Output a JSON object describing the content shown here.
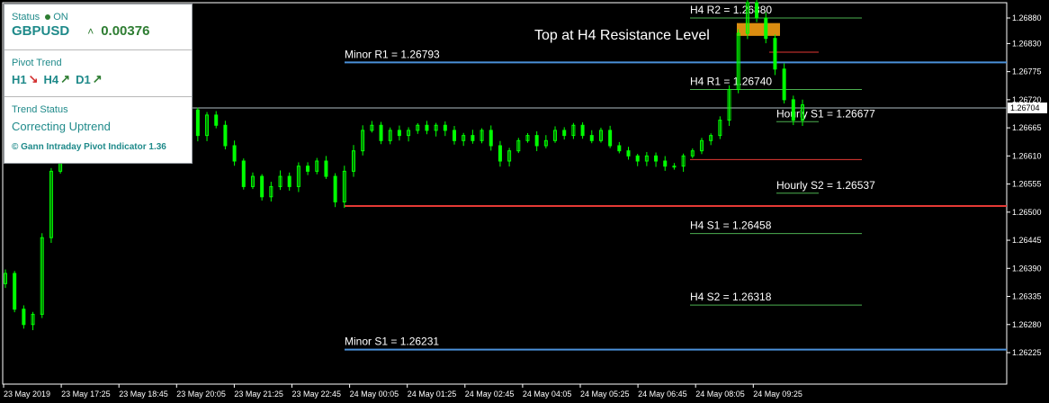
{
  "panel": {
    "status_label": "Status",
    "status_value": "ON",
    "symbol": "GBPUSD",
    "change": "0.00376",
    "pivot_trend_label": "Pivot Trend",
    "trend_items": [
      {
        "tf": "H1",
        "dir": "down"
      },
      {
        "tf": "H4",
        "dir": "up"
      },
      {
        "tf": "D1",
        "dir": "up"
      }
    ],
    "trend_status_label": "Trend Status",
    "trend_status_value": "Correcting Uptrend",
    "copyright": "© Gann Intraday Pivot Indicator 1.36"
  },
  "chart_data": {
    "type": "candlestick",
    "symbol": "GBPUSD",
    "annotation": "Top at H4 Resistance Level",
    "current_price": 1.26704,
    "y_ticks": [
      "1.26880",
      "1.26830",
      "1.26775",
      "1.26720",
      "1.26665",
      "1.26610",
      "1.26555",
      "1.26500",
      "1.26445",
      "1.26390",
      "1.26335",
      "1.26280",
      "1.26225"
    ],
    "x_ticks": [
      "23 May 2019",
      "23 May 17:25",
      "23 May 18:45",
      "23 May 20:05",
      "23 May 21:25",
      "23 May 22:45",
      "24 May 00:05",
      "24 May 01:25",
      "24 May 02:45",
      "24 May 04:05",
      "24 May 05:25",
      "24 May 06:45",
      "24 May 08:05",
      "24 May 09:25"
    ],
    "levels": [
      {
        "label": "H4 R2 = 1.26880",
        "price": 1.2688,
        "color": "#4caf50"
      },
      {
        "label": "Minor R1 = 1.26793",
        "price": 1.26793,
        "color": "#4a90d9"
      },
      {
        "label": "H4 R1 = 1.26740",
        "price": 1.2674,
        "color": "#4caf50"
      },
      {
        "label": "Hourly S1 = 1.26677",
        "price": 1.26677,
        "color": "#4caf50"
      },
      {
        "label": "Hourly S2 = 1.26537",
        "price": 1.26537,
        "color": "#4caf50"
      },
      {
        "label": "H4 S1 = 1.26458",
        "price": 1.26458,
        "color": "#4caf50"
      },
      {
        "label": "H4 S2 = 1.26318",
        "price": 1.26318,
        "color": "#4caf50"
      },
      {
        "label": "Minor S1 = 1.26231",
        "price": 1.26231,
        "color": "#4a90d9"
      }
    ],
    "series": [
      {
        "close": [
          1.2638,
          1.2631,
          1.2628,
          1.263,
          1.2645,
          1.2658,
          1.2668,
          1.2663,
          1.2675,
          1.267,
          1.268,
          1.2675,
          1.2668,
          1.2666,
          1.267,
          1.2668,
          1.2665,
          1.2669,
          1.2672,
          1.2668,
          1.267,
          1.2665,
          1.2669,
          1.2667,
          1.2663,
          1.266,
          1.2655,
          1.2657,
          1.2653,
          1.2655,
          1.2657,
          1.2655,
          1.2659,
          1.2658,
          1.266,
          1.2657,
          1.2652,
          1.2658,
          1.2662,
          1.2666,
          1.2667,
          1.2664,
          1.2666,
          1.2665,
          1.2666,
          1.2667,
          1.2666,
          1.2667,
          1.2666,
          1.2664,
          1.2665,
          1.2664,
          1.2666,
          1.2663,
          1.266,
          1.2662,
          1.2664,
          1.2665,
          1.2663,
          1.2664,
          1.2666,
          1.2665,
          1.2667,
          1.2665,
          1.2664,
          1.2666,
          1.2663,
          1.2662,
          1.2661,
          1.266,
          1.2661,
          1.266,
          1.2659,
          1.2659,
          1.2661,
          1.2662,
          1.2664,
          1.2665,
          1.2668,
          1.2674,
          1.2685,
          1.2691,
          1.2688,
          1.2684,
          1.2678,
          1.2672,
          1.2668,
          1.2671
        ]
      }
    ],
    "colors": {
      "candle": "#00ff00",
      "current_line": "#b0bec5",
      "extra_line": "#e53935"
    }
  }
}
